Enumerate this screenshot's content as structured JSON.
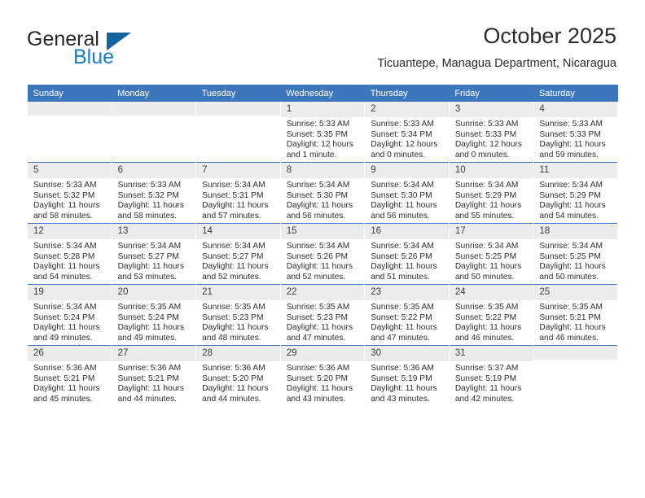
{
  "brand": {
    "name_part1": "General",
    "name_part2": "Blue",
    "logo_icon": "triangle-flag-icon"
  },
  "header": {
    "month_title": "October 2025",
    "location": "Ticuantepe, Managua Department, Nicaragua"
  },
  "theme": {
    "header_blue": "#3b77ba",
    "logo_blue": "#1b7bc4",
    "daynum_bg": "#ececec"
  },
  "weekdays": [
    "Sunday",
    "Monday",
    "Tuesday",
    "Wednesday",
    "Thursday",
    "Friday",
    "Saturday"
  ],
  "weeks": [
    [
      {
        "day": "",
        "empty": true,
        "sunrise": "",
        "sunset": "",
        "daylight1": "",
        "daylight2": ""
      },
      {
        "day": "",
        "empty": true,
        "sunrise": "",
        "sunset": "",
        "daylight1": "",
        "daylight2": ""
      },
      {
        "day": "",
        "empty": true,
        "sunrise": "",
        "sunset": "",
        "daylight1": "",
        "daylight2": ""
      },
      {
        "day": "1",
        "sunrise": "Sunrise: 5:33 AM",
        "sunset": "Sunset: 5:35 PM",
        "daylight1": "Daylight: 12 hours",
        "daylight2": "and 1 minute."
      },
      {
        "day": "2",
        "sunrise": "Sunrise: 5:33 AM",
        "sunset": "Sunset: 5:34 PM",
        "daylight1": "Daylight: 12 hours",
        "daylight2": "and 0 minutes."
      },
      {
        "day": "3",
        "sunrise": "Sunrise: 5:33 AM",
        "sunset": "Sunset: 5:33 PM",
        "daylight1": "Daylight: 12 hours",
        "daylight2": "and 0 minutes."
      },
      {
        "day": "4",
        "sunrise": "Sunrise: 5:33 AM",
        "sunset": "Sunset: 5:33 PM",
        "daylight1": "Daylight: 11 hours",
        "daylight2": "and 59 minutes."
      }
    ],
    [
      {
        "day": "5",
        "sunrise": "Sunrise: 5:33 AM",
        "sunset": "Sunset: 5:32 PM",
        "daylight1": "Daylight: 11 hours",
        "daylight2": "and 58 minutes."
      },
      {
        "day": "6",
        "sunrise": "Sunrise: 5:33 AM",
        "sunset": "Sunset: 5:32 PM",
        "daylight1": "Daylight: 11 hours",
        "daylight2": "and 58 minutes."
      },
      {
        "day": "7",
        "sunrise": "Sunrise: 5:34 AM",
        "sunset": "Sunset: 5:31 PM",
        "daylight1": "Daylight: 11 hours",
        "daylight2": "and 57 minutes."
      },
      {
        "day": "8",
        "sunrise": "Sunrise: 5:34 AM",
        "sunset": "Sunset: 5:30 PM",
        "daylight1": "Daylight: 11 hours",
        "daylight2": "and 56 minutes."
      },
      {
        "day": "9",
        "sunrise": "Sunrise: 5:34 AM",
        "sunset": "Sunset: 5:30 PM",
        "daylight1": "Daylight: 11 hours",
        "daylight2": "and 56 minutes."
      },
      {
        "day": "10",
        "sunrise": "Sunrise: 5:34 AM",
        "sunset": "Sunset: 5:29 PM",
        "daylight1": "Daylight: 11 hours",
        "daylight2": "and 55 minutes."
      },
      {
        "day": "11",
        "sunrise": "Sunrise: 5:34 AM",
        "sunset": "Sunset: 5:29 PM",
        "daylight1": "Daylight: 11 hours",
        "daylight2": "and 54 minutes."
      }
    ],
    [
      {
        "day": "12",
        "sunrise": "Sunrise: 5:34 AM",
        "sunset": "Sunset: 5:28 PM",
        "daylight1": "Daylight: 11 hours",
        "daylight2": "and 54 minutes."
      },
      {
        "day": "13",
        "sunrise": "Sunrise: 5:34 AM",
        "sunset": "Sunset: 5:27 PM",
        "daylight1": "Daylight: 11 hours",
        "daylight2": "and 53 minutes."
      },
      {
        "day": "14",
        "sunrise": "Sunrise: 5:34 AM",
        "sunset": "Sunset: 5:27 PM",
        "daylight1": "Daylight: 11 hours",
        "daylight2": "and 52 minutes."
      },
      {
        "day": "15",
        "sunrise": "Sunrise: 5:34 AM",
        "sunset": "Sunset: 5:26 PM",
        "daylight1": "Daylight: 11 hours",
        "daylight2": "and 52 minutes."
      },
      {
        "day": "16",
        "sunrise": "Sunrise: 5:34 AM",
        "sunset": "Sunset: 5:26 PM",
        "daylight1": "Daylight: 11 hours",
        "daylight2": "and 51 minutes."
      },
      {
        "day": "17",
        "sunrise": "Sunrise: 5:34 AM",
        "sunset": "Sunset: 5:25 PM",
        "daylight1": "Daylight: 11 hours",
        "daylight2": "and 50 minutes."
      },
      {
        "day": "18",
        "sunrise": "Sunrise: 5:34 AM",
        "sunset": "Sunset: 5:25 PM",
        "daylight1": "Daylight: 11 hours",
        "daylight2": "and 50 minutes."
      }
    ],
    [
      {
        "day": "19",
        "sunrise": "Sunrise: 5:34 AM",
        "sunset": "Sunset: 5:24 PM",
        "daylight1": "Daylight: 11 hours",
        "daylight2": "and 49 minutes."
      },
      {
        "day": "20",
        "sunrise": "Sunrise: 5:35 AM",
        "sunset": "Sunset: 5:24 PM",
        "daylight1": "Daylight: 11 hours",
        "daylight2": "and 49 minutes."
      },
      {
        "day": "21",
        "sunrise": "Sunrise: 5:35 AM",
        "sunset": "Sunset: 5:23 PM",
        "daylight1": "Daylight: 11 hours",
        "daylight2": "and 48 minutes."
      },
      {
        "day": "22",
        "sunrise": "Sunrise: 5:35 AM",
        "sunset": "Sunset: 5:23 PM",
        "daylight1": "Daylight: 11 hours",
        "daylight2": "and 47 minutes."
      },
      {
        "day": "23",
        "sunrise": "Sunrise: 5:35 AM",
        "sunset": "Sunset: 5:22 PM",
        "daylight1": "Daylight: 11 hours",
        "daylight2": "and 47 minutes."
      },
      {
        "day": "24",
        "sunrise": "Sunrise: 5:35 AM",
        "sunset": "Sunset: 5:22 PM",
        "daylight1": "Daylight: 11 hours",
        "daylight2": "and 46 minutes."
      },
      {
        "day": "25",
        "sunrise": "Sunrise: 5:35 AM",
        "sunset": "Sunset: 5:21 PM",
        "daylight1": "Daylight: 11 hours",
        "daylight2": "and 46 minutes."
      }
    ],
    [
      {
        "day": "26",
        "sunrise": "Sunrise: 5:36 AM",
        "sunset": "Sunset: 5:21 PM",
        "daylight1": "Daylight: 11 hours",
        "daylight2": "and 45 minutes."
      },
      {
        "day": "27",
        "sunrise": "Sunrise: 5:36 AM",
        "sunset": "Sunset: 5:21 PM",
        "daylight1": "Daylight: 11 hours",
        "daylight2": "and 44 minutes."
      },
      {
        "day": "28",
        "sunrise": "Sunrise: 5:36 AM",
        "sunset": "Sunset: 5:20 PM",
        "daylight1": "Daylight: 11 hours",
        "daylight2": "and 44 minutes."
      },
      {
        "day": "29",
        "sunrise": "Sunrise: 5:36 AM",
        "sunset": "Sunset: 5:20 PM",
        "daylight1": "Daylight: 11 hours",
        "daylight2": "and 43 minutes."
      },
      {
        "day": "30",
        "sunrise": "Sunrise: 5:36 AM",
        "sunset": "Sunset: 5:19 PM",
        "daylight1": "Daylight: 11 hours",
        "daylight2": "and 43 minutes."
      },
      {
        "day": "31",
        "sunrise": "Sunrise: 5:37 AM",
        "sunset": "Sunset: 5:19 PM",
        "daylight1": "Daylight: 11 hours",
        "daylight2": "and 42 minutes."
      },
      {
        "day": "",
        "empty": true,
        "sunrise": "",
        "sunset": "",
        "daylight1": "",
        "daylight2": ""
      }
    ]
  ]
}
